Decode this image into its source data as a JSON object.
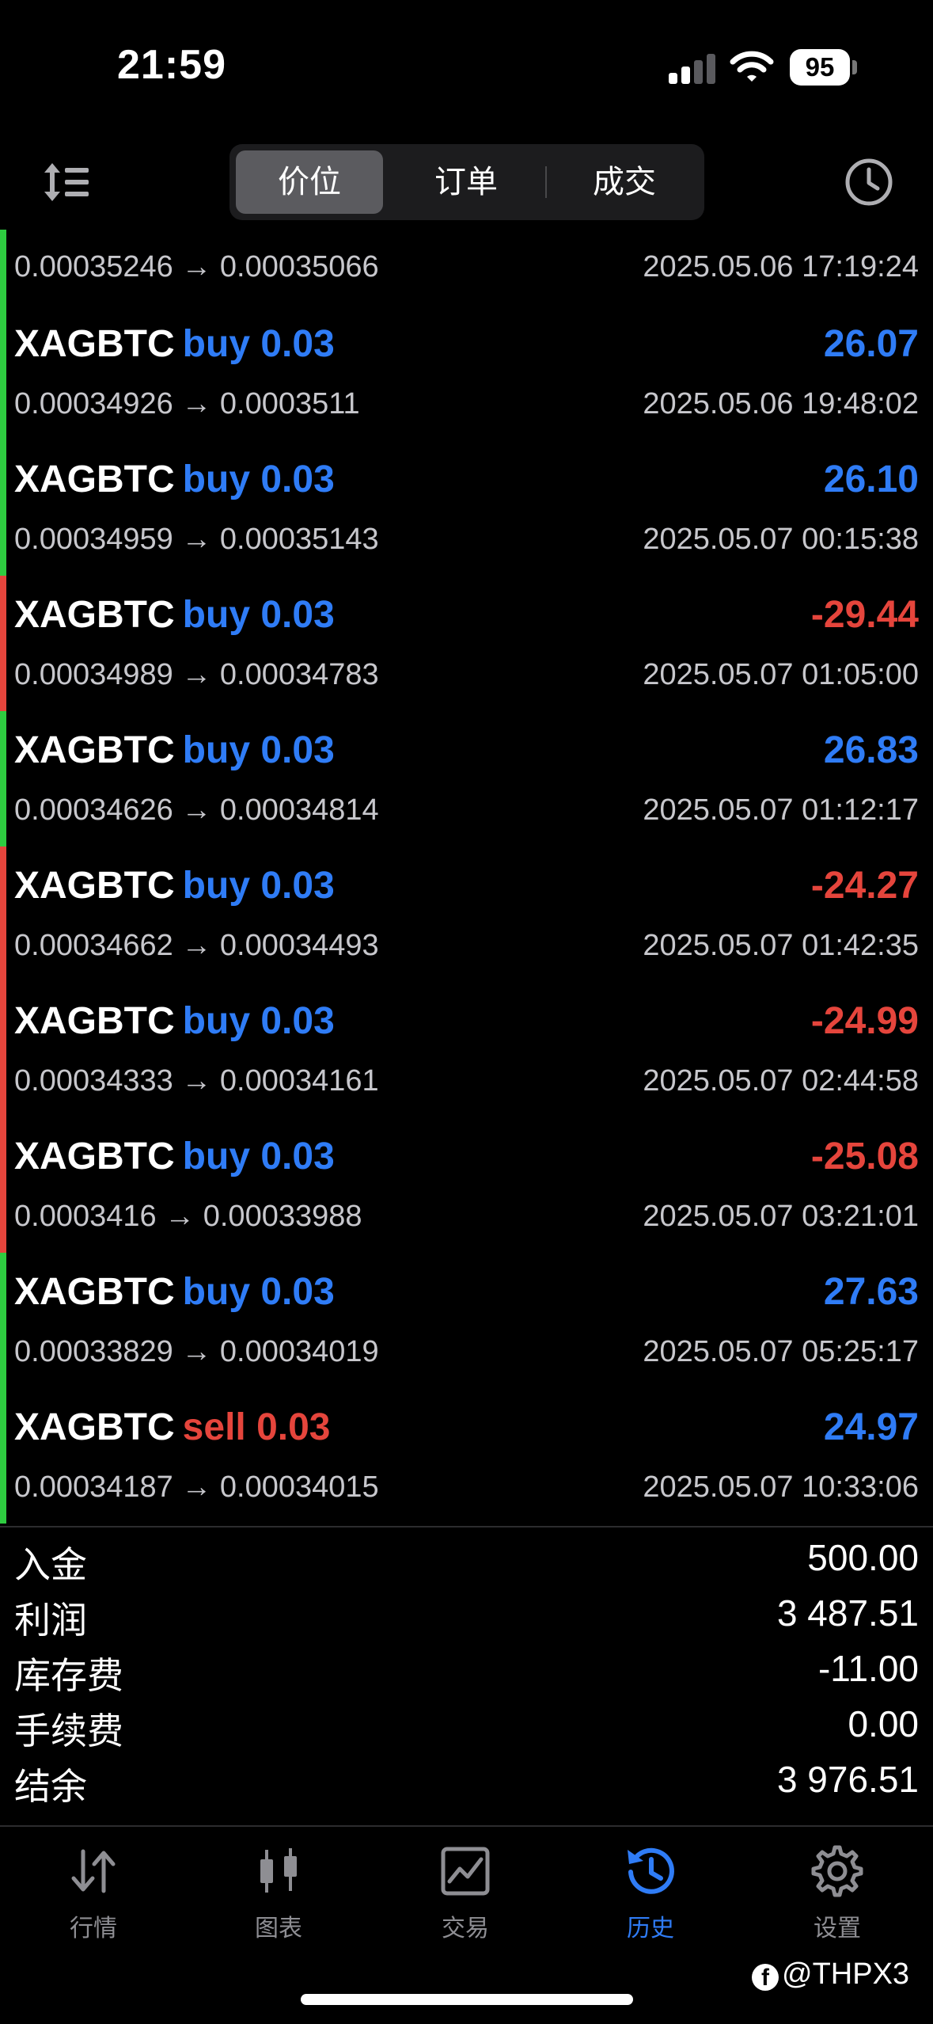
{
  "status_bar": {
    "time": "21:59",
    "battery": "95"
  },
  "toolbar": {
    "segments": [
      {
        "label": "价位",
        "active": true
      },
      {
        "label": "订单",
        "active": false
      },
      {
        "label": "成交",
        "active": false
      }
    ]
  },
  "colors": {
    "profit": "#2f7cf6",
    "loss": "#e5453c",
    "bar_green": "#2ecc40",
    "bar_red": "#e5453c",
    "active_tab": "#2f7cf6"
  },
  "trades": {
    "first_partial": {
      "prices": "0.00035246 → 0.00035066",
      "time": "2025.05.06 17:19:24",
      "result": "profit"
    },
    "rows": [
      {
        "symbol": "XAGBTC",
        "side": "buy 0.03",
        "side_type": "buy",
        "profit": "26.07",
        "result": "profit",
        "prices": "0.00034926 → 0.0003511",
        "time": "2025.05.06 19:48:02"
      },
      {
        "symbol": "XAGBTC",
        "side": "buy 0.03",
        "side_type": "buy",
        "profit": "26.10",
        "result": "profit",
        "prices": "0.00034959 → 0.00035143",
        "time": "2025.05.07 00:15:38"
      },
      {
        "symbol": "XAGBTC",
        "side": "buy 0.03",
        "side_type": "buy",
        "profit": "-29.44",
        "result": "loss",
        "prices": "0.00034989 → 0.00034783",
        "time": "2025.05.07 01:05:00"
      },
      {
        "symbol": "XAGBTC",
        "side": "buy 0.03",
        "side_type": "buy",
        "profit": "26.83",
        "result": "profit",
        "prices": "0.00034626 → 0.00034814",
        "time": "2025.05.07 01:12:17"
      },
      {
        "symbol": "XAGBTC",
        "side": "buy 0.03",
        "side_type": "buy",
        "profit": "-24.27",
        "result": "loss",
        "prices": "0.00034662 → 0.00034493",
        "time": "2025.05.07 01:42:35"
      },
      {
        "symbol": "XAGBTC",
        "side": "buy 0.03",
        "side_type": "buy",
        "profit": "-24.99",
        "result": "loss",
        "prices": "0.00034333 → 0.00034161",
        "time": "2025.05.07 02:44:58"
      },
      {
        "symbol": "XAGBTC",
        "side": "buy 0.03",
        "side_type": "buy",
        "profit": "-25.08",
        "result": "loss",
        "prices": "0.0003416 → 0.00033988",
        "time": "2025.05.07 03:21:01"
      },
      {
        "symbol": "XAGBTC",
        "side": "buy 0.03",
        "side_type": "buy",
        "profit": "27.63",
        "result": "profit",
        "prices": "0.00033829 → 0.00034019",
        "time": "2025.05.07 05:25:17"
      },
      {
        "symbol": "XAGBTC",
        "side": "sell 0.03",
        "side_type": "sell",
        "profit": "24.97",
        "result": "profit",
        "prices": "0.00034187 → 0.00034015",
        "time": "2025.05.07 10:33:06"
      }
    ]
  },
  "summary": [
    {
      "label": "入金",
      "value": "500.00"
    },
    {
      "label": "利润",
      "value": "3 487.51"
    },
    {
      "label": "库存费",
      "value": "-11.00"
    },
    {
      "label": "手续费",
      "value": "0.00"
    },
    {
      "label": "结余",
      "value": "3 976.51"
    }
  ],
  "tabbar": {
    "tabs": [
      {
        "label": "行情",
        "icon": "quotes-arrows-icon",
        "active": false
      },
      {
        "label": "图表",
        "icon": "candlestick-chart-icon",
        "active": false
      },
      {
        "label": "交易",
        "icon": "trade-chart-icon",
        "active": false
      },
      {
        "label": "历史",
        "icon": "history-clock-icon",
        "active": true
      },
      {
        "label": "设置",
        "icon": "gear-icon",
        "active": false
      }
    ]
  },
  "watermark": {
    "text": "@THPX3"
  }
}
